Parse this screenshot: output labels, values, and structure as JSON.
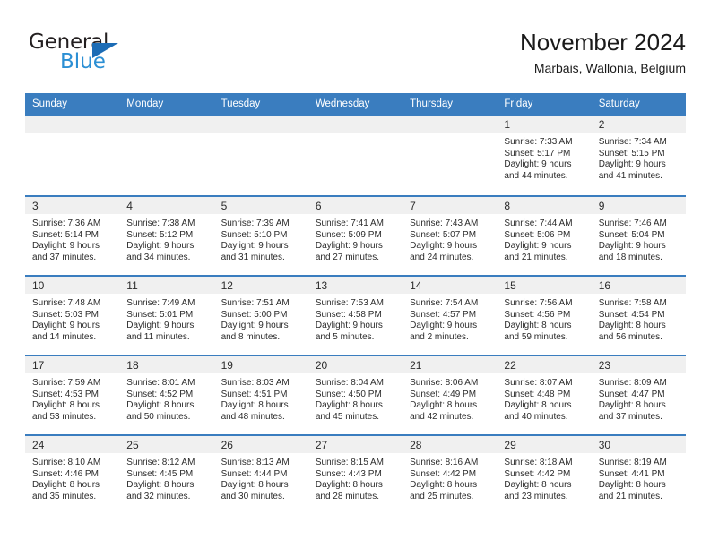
{
  "branding": {
    "logo_primary": "General",
    "logo_secondary": "Blue"
  },
  "header": {
    "month_title": "November 2024",
    "location": "Marbais, Wallonia, Belgium"
  },
  "calendar": {
    "weekday_headers": [
      "Sunday",
      "Monday",
      "Tuesday",
      "Wednesday",
      "Thursday",
      "Friday",
      "Saturday"
    ],
    "accent_color": "#3a7dbf",
    "day_band_color": "#f0f0f0",
    "weeks": [
      [
        {
          "day": "",
          "sunrise": "",
          "sunset": "",
          "daylight_line1": "",
          "daylight_line2": ""
        },
        {
          "day": "",
          "sunrise": "",
          "sunset": "",
          "daylight_line1": "",
          "daylight_line2": ""
        },
        {
          "day": "",
          "sunrise": "",
          "sunset": "",
          "daylight_line1": "",
          "daylight_line2": ""
        },
        {
          "day": "",
          "sunrise": "",
          "sunset": "",
          "daylight_line1": "",
          "daylight_line2": ""
        },
        {
          "day": "",
          "sunrise": "",
          "sunset": "",
          "daylight_line1": "",
          "daylight_line2": ""
        },
        {
          "day": "1",
          "sunrise": "Sunrise: 7:33 AM",
          "sunset": "Sunset: 5:17 PM",
          "daylight_line1": "Daylight: 9 hours",
          "daylight_line2": "and 44 minutes."
        },
        {
          "day": "2",
          "sunrise": "Sunrise: 7:34 AM",
          "sunset": "Sunset: 5:15 PM",
          "daylight_line1": "Daylight: 9 hours",
          "daylight_line2": "and 41 minutes."
        }
      ],
      [
        {
          "day": "3",
          "sunrise": "Sunrise: 7:36 AM",
          "sunset": "Sunset: 5:14 PM",
          "daylight_line1": "Daylight: 9 hours",
          "daylight_line2": "and 37 minutes."
        },
        {
          "day": "4",
          "sunrise": "Sunrise: 7:38 AM",
          "sunset": "Sunset: 5:12 PM",
          "daylight_line1": "Daylight: 9 hours",
          "daylight_line2": "and 34 minutes."
        },
        {
          "day": "5",
          "sunrise": "Sunrise: 7:39 AM",
          "sunset": "Sunset: 5:10 PM",
          "daylight_line1": "Daylight: 9 hours",
          "daylight_line2": "and 31 minutes."
        },
        {
          "day": "6",
          "sunrise": "Sunrise: 7:41 AM",
          "sunset": "Sunset: 5:09 PM",
          "daylight_line1": "Daylight: 9 hours",
          "daylight_line2": "and 27 minutes."
        },
        {
          "day": "7",
          "sunrise": "Sunrise: 7:43 AM",
          "sunset": "Sunset: 5:07 PM",
          "daylight_line1": "Daylight: 9 hours",
          "daylight_line2": "and 24 minutes."
        },
        {
          "day": "8",
          "sunrise": "Sunrise: 7:44 AM",
          "sunset": "Sunset: 5:06 PM",
          "daylight_line1": "Daylight: 9 hours",
          "daylight_line2": "and 21 minutes."
        },
        {
          "day": "9",
          "sunrise": "Sunrise: 7:46 AM",
          "sunset": "Sunset: 5:04 PM",
          "daylight_line1": "Daylight: 9 hours",
          "daylight_line2": "and 18 minutes."
        }
      ],
      [
        {
          "day": "10",
          "sunrise": "Sunrise: 7:48 AM",
          "sunset": "Sunset: 5:03 PM",
          "daylight_line1": "Daylight: 9 hours",
          "daylight_line2": "and 14 minutes."
        },
        {
          "day": "11",
          "sunrise": "Sunrise: 7:49 AM",
          "sunset": "Sunset: 5:01 PM",
          "daylight_line1": "Daylight: 9 hours",
          "daylight_line2": "and 11 minutes."
        },
        {
          "day": "12",
          "sunrise": "Sunrise: 7:51 AM",
          "sunset": "Sunset: 5:00 PM",
          "daylight_line1": "Daylight: 9 hours",
          "daylight_line2": "and 8 minutes."
        },
        {
          "day": "13",
          "sunrise": "Sunrise: 7:53 AM",
          "sunset": "Sunset: 4:58 PM",
          "daylight_line1": "Daylight: 9 hours",
          "daylight_line2": "and 5 minutes."
        },
        {
          "day": "14",
          "sunrise": "Sunrise: 7:54 AM",
          "sunset": "Sunset: 4:57 PM",
          "daylight_line1": "Daylight: 9 hours",
          "daylight_line2": "and 2 minutes."
        },
        {
          "day": "15",
          "sunrise": "Sunrise: 7:56 AM",
          "sunset": "Sunset: 4:56 PM",
          "daylight_line1": "Daylight: 8 hours",
          "daylight_line2": "and 59 minutes."
        },
        {
          "day": "16",
          "sunrise": "Sunrise: 7:58 AM",
          "sunset": "Sunset: 4:54 PM",
          "daylight_line1": "Daylight: 8 hours",
          "daylight_line2": "and 56 minutes."
        }
      ],
      [
        {
          "day": "17",
          "sunrise": "Sunrise: 7:59 AM",
          "sunset": "Sunset: 4:53 PM",
          "daylight_line1": "Daylight: 8 hours",
          "daylight_line2": "and 53 minutes."
        },
        {
          "day": "18",
          "sunrise": "Sunrise: 8:01 AM",
          "sunset": "Sunset: 4:52 PM",
          "daylight_line1": "Daylight: 8 hours",
          "daylight_line2": "and 50 minutes."
        },
        {
          "day": "19",
          "sunrise": "Sunrise: 8:03 AM",
          "sunset": "Sunset: 4:51 PM",
          "daylight_line1": "Daylight: 8 hours",
          "daylight_line2": "and 48 minutes."
        },
        {
          "day": "20",
          "sunrise": "Sunrise: 8:04 AM",
          "sunset": "Sunset: 4:50 PM",
          "daylight_line1": "Daylight: 8 hours",
          "daylight_line2": "and 45 minutes."
        },
        {
          "day": "21",
          "sunrise": "Sunrise: 8:06 AM",
          "sunset": "Sunset: 4:49 PM",
          "daylight_line1": "Daylight: 8 hours",
          "daylight_line2": "and 42 minutes."
        },
        {
          "day": "22",
          "sunrise": "Sunrise: 8:07 AM",
          "sunset": "Sunset: 4:48 PM",
          "daylight_line1": "Daylight: 8 hours",
          "daylight_line2": "and 40 minutes."
        },
        {
          "day": "23",
          "sunrise": "Sunrise: 8:09 AM",
          "sunset": "Sunset: 4:47 PM",
          "daylight_line1": "Daylight: 8 hours",
          "daylight_line2": "and 37 minutes."
        }
      ],
      [
        {
          "day": "24",
          "sunrise": "Sunrise: 8:10 AM",
          "sunset": "Sunset: 4:46 PM",
          "daylight_line1": "Daylight: 8 hours",
          "daylight_line2": "and 35 minutes."
        },
        {
          "day": "25",
          "sunrise": "Sunrise: 8:12 AM",
          "sunset": "Sunset: 4:45 PM",
          "daylight_line1": "Daylight: 8 hours",
          "daylight_line2": "and 32 minutes."
        },
        {
          "day": "26",
          "sunrise": "Sunrise: 8:13 AM",
          "sunset": "Sunset: 4:44 PM",
          "daylight_line1": "Daylight: 8 hours",
          "daylight_line2": "and 30 minutes."
        },
        {
          "day": "27",
          "sunrise": "Sunrise: 8:15 AM",
          "sunset": "Sunset: 4:43 PM",
          "daylight_line1": "Daylight: 8 hours",
          "daylight_line2": "and 28 minutes."
        },
        {
          "day": "28",
          "sunrise": "Sunrise: 8:16 AM",
          "sunset": "Sunset: 4:42 PM",
          "daylight_line1": "Daylight: 8 hours",
          "daylight_line2": "and 25 minutes."
        },
        {
          "day": "29",
          "sunrise": "Sunrise: 8:18 AM",
          "sunset": "Sunset: 4:42 PM",
          "daylight_line1": "Daylight: 8 hours",
          "daylight_line2": "and 23 minutes."
        },
        {
          "day": "30",
          "sunrise": "Sunrise: 8:19 AM",
          "sunset": "Sunset: 4:41 PM",
          "daylight_line1": "Daylight: 8 hours",
          "daylight_line2": "and 21 minutes."
        }
      ]
    ]
  }
}
